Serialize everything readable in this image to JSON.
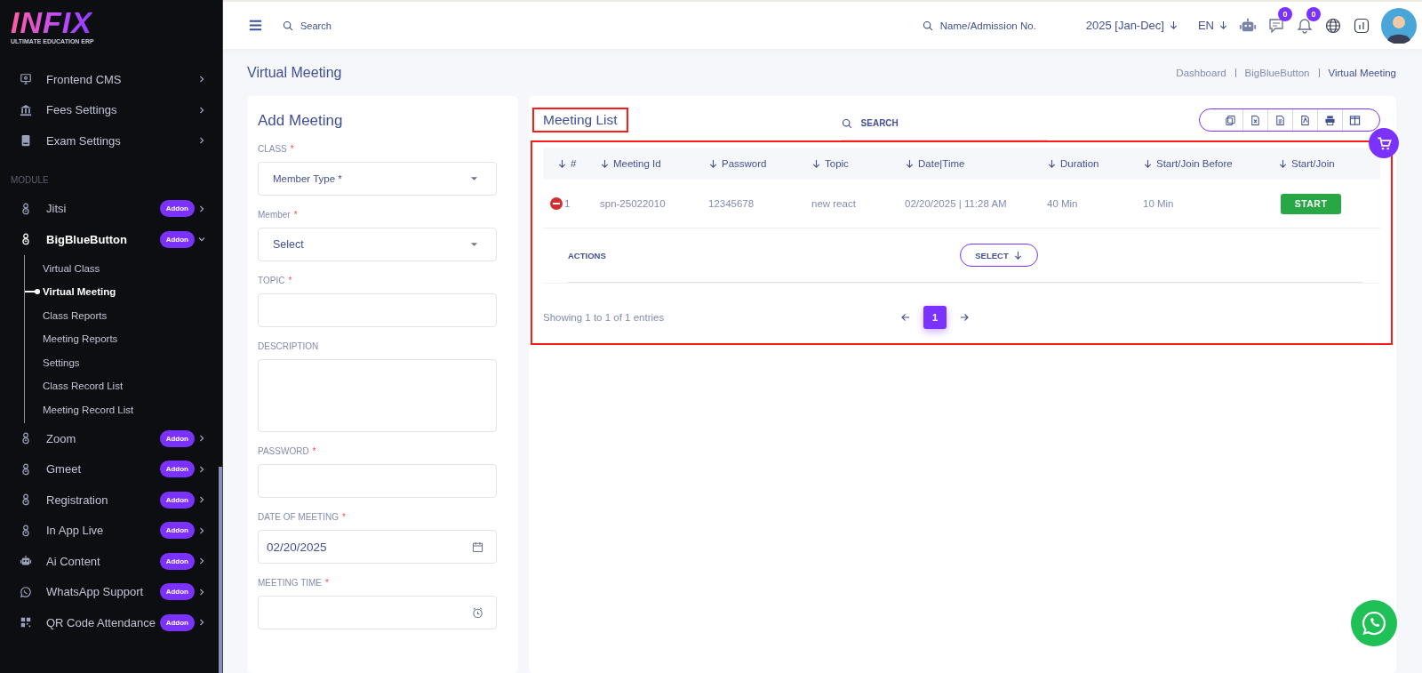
{
  "sidebar": {
    "logo": {
      "name": "INFIX",
      "tagline": "ULTIMATE EDUCATION ERP"
    },
    "top_items": [
      {
        "label": "Frontend CMS",
        "expanded": false
      },
      {
        "label": "Fees Settings",
        "expanded": false
      },
      {
        "label": "Exam Settings",
        "expanded": false
      }
    ],
    "section_label": "MODULE",
    "module_items": [
      {
        "label": "Jitsi",
        "badge": "Addon",
        "expanded": false
      },
      {
        "label": "BigBlueButton",
        "badge": "Addon",
        "expanded": true,
        "children": [
          {
            "label": "Virtual Class",
            "selected": false
          },
          {
            "label": "Virtual Meeting",
            "selected": true
          },
          {
            "label": "Class Reports",
            "selected": false
          },
          {
            "label": "Meeting Reports",
            "selected": false
          },
          {
            "label": "Settings",
            "selected": false
          },
          {
            "label": "Class Record List",
            "selected": false
          },
          {
            "label": "Meeting Record List",
            "selected": false
          }
        ]
      },
      {
        "label": "Zoom",
        "badge": "Addon",
        "expanded": false
      },
      {
        "label": "Gmeet",
        "badge": "Addon",
        "expanded": false
      },
      {
        "label": "Registration",
        "badge": "Addon",
        "expanded": false
      },
      {
        "label": "In App Live",
        "badge": "Addon",
        "expanded": false
      },
      {
        "label": "Ai Content",
        "badge": "Addon",
        "expanded": false
      },
      {
        "label": "WhatsApp Support",
        "badge": "Addon",
        "expanded": false
      },
      {
        "label": "QR Code Attendance",
        "badge": "Addon",
        "expanded": false
      }
    ]
  },
  "header": {
    "search": {
      "placeholder": "Search"
    },
    "student_search": {
      "placeholder": "Name/Admission No."
    },
    "year": "2025 [Jan-Dec]",
    "language": "EN",
    "message_count": "0",
    "notification_count": "0"
  },
  "page": {
    "title": "Virtual Meeting",
    "breadcrumbs": [
      "Dashboard",
      "BigBlueButton",
      "Virtual Meeting"
    ]
  },
  "form": {
    "title": "Add Meeting",
    "fields": [
      {
        "label": "CLASS",
        "required_mark": "*",
        "kind": "select",
        "value": "Member Type *"
      },
      {
        "label": "Member",
        "required_mark": "*",
        "kind": "select",
        "value": "Select"
      },
      {
        "label": "TOPIC",
        "required_mark": "*",
        "kind": "text"
      },
      {
        "label": "DESCRIPTION",
        "kind": "textarea"
      },
      {
        "label": "PASSWORD",
        "required_mark": "*",
        "kind": "text"
      },
      {
        "label": "DATE OF MEETING",
        "required_mark": "*",
        "kind": "date",
        "value": "02/20/2025"
      },
      {
        "label": "MEETING TIME",
        "required_mark": "*",
        "kind": "time"
      }
    ]
  },
  "meeting_list": {
    "title": "Meeting List",
    "search": {
      "placeholder": "SEARCH"
    },
    "columns": [
      "#",
      "Meeting Id",
      "Password",
      "Topic",
      "Date|Time",
      "Duration",
      "Start/Join Before",
      "Start/Join"
    ],
    "rows": [
      {
        "number": "1",
        "meeting_id": "spn-25022010",
        "password": "12345678",
        "topic": "new react",
        "date_time": "02/20/2025 | 11:28 AM",
        "duration": "40 Min",
        "join_before": "10 Min",
        "action": "START"
      }
    ],
    "actions_label": "ACTIONS",
    "select_button": "SELECT",
    "footer": "Showing 1 to 1 of 1 entries",
    "pages": [
      {
        "label": "1",
        "selected": true
      }
    ]
  }
}
